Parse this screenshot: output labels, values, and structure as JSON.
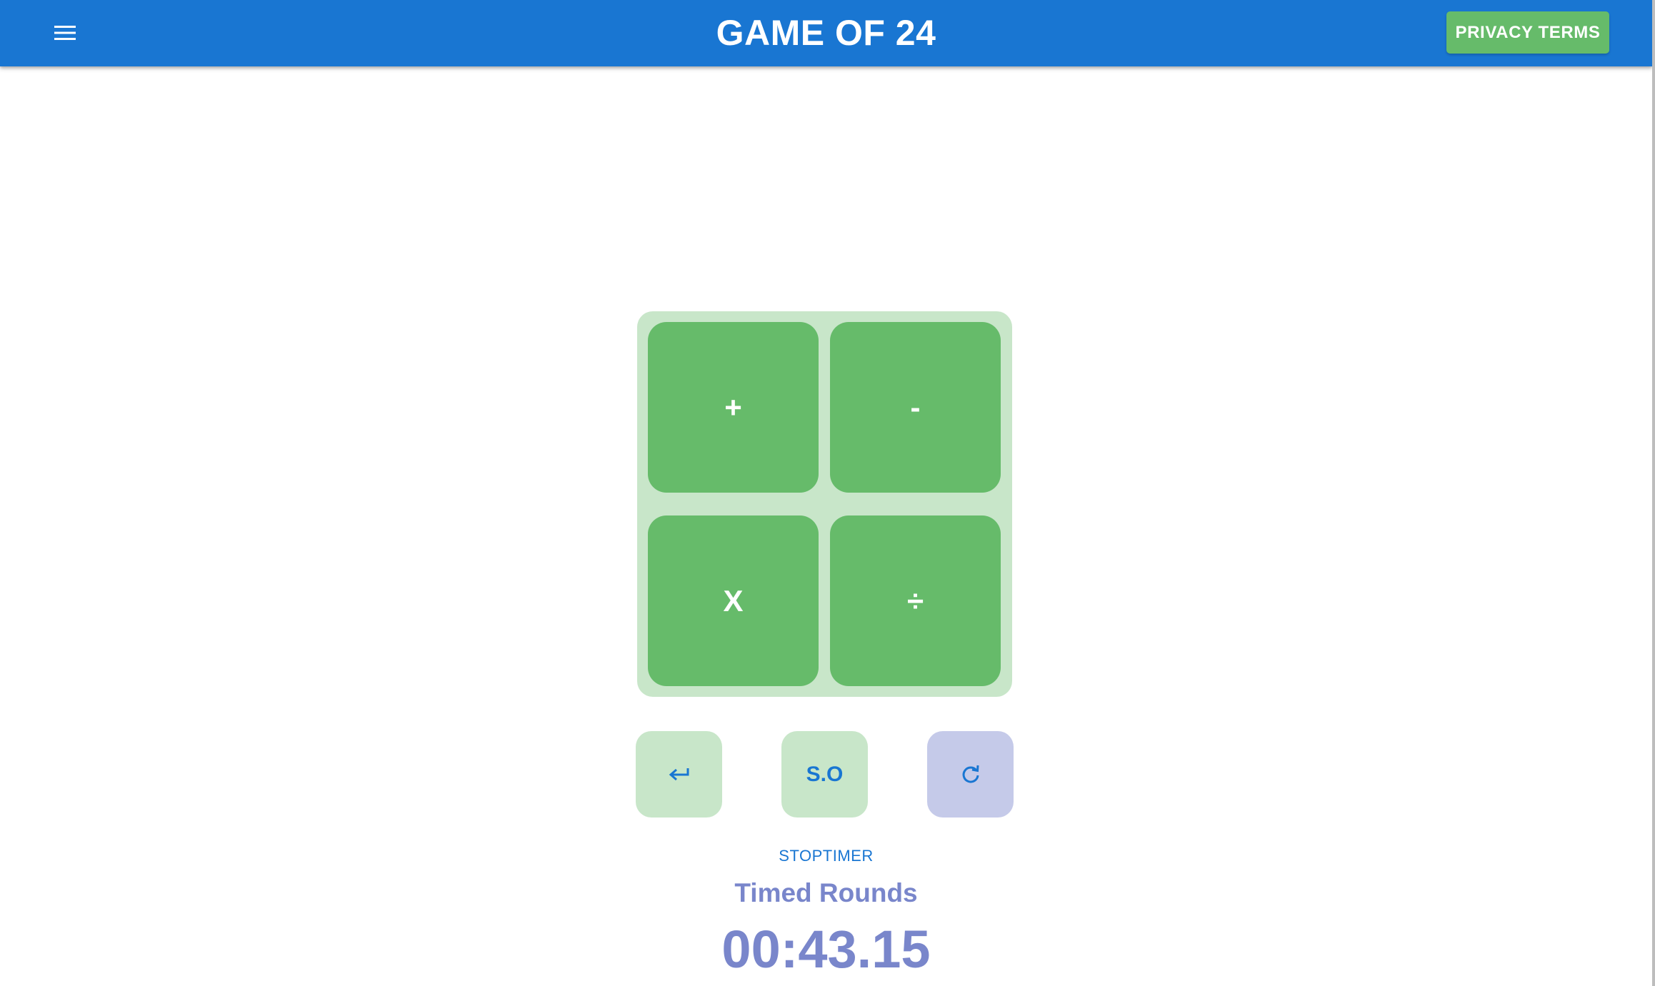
{
  "header": {
    "title": "GAME OF 24",
    "menu_icon": "hamburger-menu-icon",
    "privacy_label": "PRIVACY TERMS"
  },
  "board": {
    "operators": [
      "+",
      "-",
      "X",
      "÷"
    ]
  },
  "controls": {
    "undo_icon": "undo-arrow-icon",
    "solve_label": "S.O",
    "reset_icon": "refresh-icon"
  },
  "timer": {
    "stop_label": "STOPTIMER",
    "mode_label": "Timed Rounds",
    "time": "00:43.15"
  },
  "colors": {
    "app_bar": "#1976d2",
    "tile": "#66bb6a",
    "board_bg": "#c8e6c9",
    "reset_bg": "#c5cae9",
    "timer_text": "#7986cb"
  }
}
